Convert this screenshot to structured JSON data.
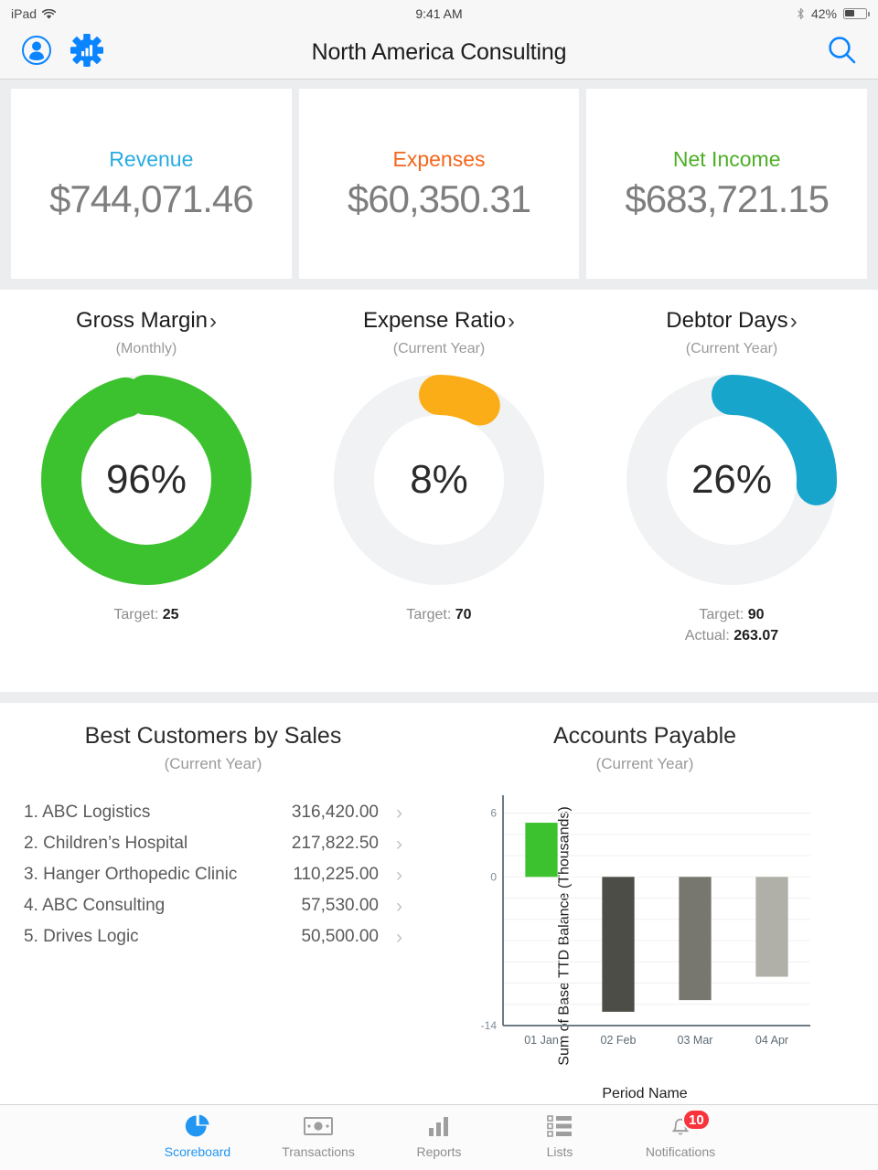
{
  "status_bar": {
    "device": "iPad",
    "wifi_icon": "wifi-icon",
    "time": "9:41 AM",
    "bluetooth_icon": "bluetooth-icon",
    "battery_percent": "42%",
    "battery_level": 42
  },
  "nav_bar": {
    "profile_icon": "person-circle-icon",
    "settings_icon": "gear-chart-icon",
    "title": "North America Consulting",
    "search_icon": "search-icon"
  },
  "kpi_cards": [
    {
      "label": "Revenue",
      "value": "$744,071.46",
      "color": "#29abe2"
    },
    {
      "label": "Expenses",
      "value": "$60,350.31",
      "color": "#f4661b"
    },
    {
      "label": "Net Income",
      "value": "$683,721.15",
      "color": "#4caf27"
    }
  ],
  "gauges": [
    {
      "title": "Gross Margin",
      "chevron": "›",
      "period": "(Monthly)",
      "percent_label": "96%",
      "percent": 96,
      "color": "#3cc22e",
      "track_color": "#f1f2f3",
      "target_label": "Target:",
      "target_value": "25",
      "actual_label": "",
      "actual_value": ""
    },
    {
      "title": "Expense Ratio",
      "chevron": "›",
      "period": "(Current Year)",
      "percent_label": "8%",
      "percent": 8,
      "color": "#fbad18",
      "track_color": "#f1f2f3",
      "target_label": "Target:",
      "target_value": "70",
      "actual_label": "",
      "actual_value": ""
    },
    {
      "title": "Debtor Days",
      "chevron": "›",
      "period": "(Current Year)",
      "percent_label": "26%",
      "percent": 26,
      "color": "#18a5cc",
      "track_color": "#f1f2f3",
      "target_label": "Target:",
      "target_value": "90",
      "actual_label": "Actual:",
      "actual_value": "263.07"
    }
  ],
  "customers_panel": {
    "title": "Best Customers by Sales",
    "subtitle": "(Current Year)",
    "chevron": "›",
    "rows": [
      {
        "rank": "1.",
        "name": "ABC Logistics",
        "amount": "316,420.00"
      },
      {
        "rank": "2.",
        "name": "Children’s Hospital",
        "amount": "217,822.50"
      },
      {
        "rank": "3.",
        "name": "Hanger Orthopedic Clinic",
        "amount": "110,225.00"
      },
      {
        "rank": "4.",
        "name": "ABC Consulting",
        "amount": "57,530.00"
      },
      {
        "rank": "5.",
        "name": "Drives Logic",
        "amount": "50,500.00"
      }
    ]
  },
  "chart_panel": {
    "title": "Accounts Payable",
    "subtitle": "(Current Year)"
  },
  "chart_data": {
    "type": "bar",
    "title": "Accounts Payable",
    "subtitle": "(Current Year)",
    "xlabel": "Period Name",
    "ylabel": "Sum of Base TTD Balance (Thousands)",
    "categories": [
      "01 Jan",
      "02 Feb",
      "03 Mar",
      "04 Apr"
    ],
    "values": [
      5.1,
      -12.7,
      -11.6,
      -9.4
    ],
    "bar_colors": [
      "#3cc22e",
      "#4d4d47",
      "#77776f",
      "#b0b0a8"
    ],
    "ylim": [
      -14,
      7
    ],
    "yticks": [
      6,
      0,
      -14
    ],
    "ytick_labels": [
      "6",
      "0",
      "-14"
    ],
    "gridlines": [
      6,
      4,
      2,
      0,
      -2,
      -4,
      -6,
      -8,
      -10,
      -12
    ],
    "grid": true,
    "legend": "none"
  },
  "tab_bar": {
    "tabs": [
      {
        "label": "Scoreboard",
        "icon": "pie-chart-icon",
        "active": true,
        "badge": ""
      },
      {
        "label": "Transactions",
        "icon": "banknote-icon",
        "active": false,
        "badge": ""
      },
      {
        "label": "Reports",
        "icon": "bar-chart-icon",
        "active": false,
        "badge": ""
      },
      {
        "label": "Lists",
        "icon": "list-icon",
        "active": false,
        "badge": ""
      },
      {
        "label": "Notifications",
        "icon": "bell-icon",
        "active": false,
        "badge": "10"
      }
    ]
  }
}
